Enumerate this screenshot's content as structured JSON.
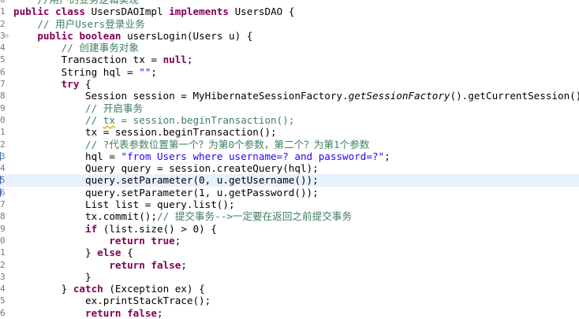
{
  "editor": {
    "lines": [
      {
        "num": "0",
        "fold": false,
        "tokens": [
          {
            "t": "    ",
            "cls": ""
          },
          {
            "t": "//用户的业务逻辑实现",
            "cls": "c"
          }
        ]
      },
      {
        "num": "1",
        "fold": false,
        "tokens": [
          {
            "t": "public",
            "cls": "k"
          },
          {
            "t": " ",
            "cls": ""
          },
          {
            "t": "class",
            "cls": "k"
          },
          {
            "t": " UsersDAOImpl ",
            "cls": ""
          },
          {
            "t": "implements",
            "cls": "k"
          },
          {
            "t": " UsersDAO {",
            "cls": ""
          }
        ]
      },
      {
        "num": "2",
        "fold": false,
        "tokens": [
          {
            "t": "    ",
            "cls": ""
          },
          {
            "t": "// 用户Users登录业务",
            "cls": "c"
          }
        ]
      },
      {
        "num": "3",
        "fold": true,
        "tokens": [
          {
            "t": "    ",
            "cls": ""
          },
          {
            "t": "public",
            "cls": "k"
          },
          {
            "t": " ",
            "cls": ""
          },
          {
            "t": "boolean",
            "cls": "k"
          },
          {
            "t": " usersLogin(Users u) {",
            "cls": ""
          }
        ]
      },
      {
        "num": "4",
        "fold": false,
        "tokens": [
          {
            "t": "        ",
            "cls": ""
          },
          {
            "t": "// 创建事务对象",
            "cls": "c"
          }
        ]
      },
      {
        "num": "5",
        "fold": false,
        "tokens": [
          {
            "t": "        Transaction tx = ",
            "cls": ""
          },
          {
            "t": "null",
            "cls": "k"
          },
          {
            "t": ";",
            "cls": ""
          }
        ]
      },
      {
        "num": "6",
        "fold": false,
        "tokens": [
          {
            "t": "        String hql = ",
            "cls": ""
          },
          {
            "t": "\"\"",
            "cls": "s"
          },
          {
            "t": ";",
            "cls": ""
          }
        ]
      },
      {
        "num": "7",
        "fold": false,
        "tokens": [
          {
            "t": "        ",
            "cls": ""
          },
          {
            "t": "try",
            "cls": "k"
          },
          {
            "t": " {",
            "cls": ""
          }
        ]
      },
      {
        "num": "8",
        "fold": false,
        "tokens": [
          {
            "t": "            Session session = MyHibernateSessionFactory.",
            "cls": ""
          },
          {
            "t": "getSessionFactory",
            "cls": "i"
          },
          {
            "t": "().getCurrentSession();",
            "cls": ""
          }
        ]
      },
      {
        "num": "9",
        "fold": false,
        "tokens": [
          {
            "t": "            ",
            "cls": ""
          },
          {
            "t": "// 开启事务",
            "cls": "c"
          }
        ]
      },
      {
        "num": "0",
        "fold": false,
        "tokens": [
          {
            "t": "            ",
            "cls": ""
          },
          {
            "t": "// ",
            "cls": "c"
          },
          {
            "t": "tx",
            "cls": "c warn"
          },
          {
            "t": " = session.beginTransaction();",
            "cls": "c"
          }
        ]
      },
      {
        "num": "1",
        "fold": false,
        "tokens": [
          {
            "t": "            tx = session.beginTransaction();",
            "cls": ""
          }
        ]
      },
      {
        "num": "2",
        "fold": false,
        "tokens": [
          {
            "t": "            ",
            "cls": ""
          },
          {
            "t": "// ?代表参数位置第一个？为第0个参数，第二个？为第1个参数",
            "cls": "c"
          }
        ]
      },
      {
        "num": "3",
        "fold": false,
        "mark": true,
        "tokens": [
          {
            "t": "            hql = ",
            "cls": ""
          },
          {
            "t": "\"from Users where username=? and password=?\"",
            "cls": "s"
          },
          {
            "t": ";",
            "cls": ""
          }
        ]
      },
      {
        "num": "4",
        "fold": false,
        "tokens": [
          {
            "t": "            Query query = session.createQuery(hql);",
            "cls": ""
          }
        ]
      },
      {
        "num": "5",
        "fold": false,
        "current": true,
        "mark": true,
        "tokens": [
          {
            "t": "            query.setParameter(0, u.getUsername());",
            "cls": ""
          }
        ]
      },
      {
        "num": "6",
        "fold": false,
        "mark": true,
        "tokens": [
          {
            "t": "            query.setParameter(1, u.getPassword());",
            "cls": ""
          }
        ]
      },
      {
        "num": "7",
        "fold": false,
        "tokens": [
          {
            "t": "            List list = query.list();",
            "cls": ""
          }
        ]
      },
      {
        "num": "8",
        "fold": false,
        "tokens": [
          {
            "t": "            tx.commit();",
            "cls": ""
          },
          {
            "t": "// 提交事务-->一定要在返回之前提交事务",
            "cls": "c"
          }
        ]
      },
      {
        "num": "9",
        "fold": false,
        "tokens": [
          {
            "t": "            ",
            "cls": ""
          },
          {
            "t": "if",
            "cls": "k"
          },
          {
            "t": " (list.size() > 0) {",
            "cls": ""
          }
        ]
      },
      {
        "num": "0",
        "fold": false,
        "tokens": [
          {
            "t": "                ",
            "cls": ""
          },
          {
            "t": "return",
            "cls": "k"
          },
          {
            "t": " ",
            "cls": ""
          },
          {
            "t": "true",
            "cls": "k"
          },
          {
            "t": ";",
            "cls": ""
          }
        ]
      },
      {
        "num": "1",
        "fold": false,
        "tokens": [
          {
            "t": "            } ",
            "cls": ""
          },
          {
            "t": "else",
            "cls": "k"
          },
          {
            "t": " {",
            "cls": ""
          }
        ]
      },
      {
        "num": "2",
        "fold": false,
        "tokens": [
          {
            "t": "                ",
            "cls": ""
          },
          {
            "t": "return",
            "cls": "k"
          },
          {
            "t": " ",
            "cls": ""
          },
          {
            "t": "false",
            "cls": "k"
          },
          {
            "t": ";",
            "cls": ""
          }
        ]
      },
      {
        "num": "3",
        "fold": false,
        "tokens": [
          {
            "t": "            }",
            "cls": ""
          }
        ]
      },
      {
        "num": "4",
        "fold": false,
        "tokens": [
          {
            "t": "        } ",
            "cls": ""
          },
          {
            "t": "catch",
            "cls": "k"
          },
          {
            "t": " (Exception ex) {",
            "cls": ""
          }
        ]
      },
      {
        "num": "5",
        "fold": false,
        "tokens": [
          {
            "t": "            ex.printStackTrace();",
            "cls": ""
          }
        ]
      },
      {
        "num": "6",
        "fold": false,
        "tokens": [
          {
            "t": "            ",
            "cls": ""
          },
          {
            "t": "return",
            "cls": "k"
          },
          {
            "t": " ",
            "cls": ""
          },
          {
            "t": "false",
            "cls": "k"
          },
          {
            "t": ";",
            "cls": ""
          }
        ]
      }
    ]
  }
}
